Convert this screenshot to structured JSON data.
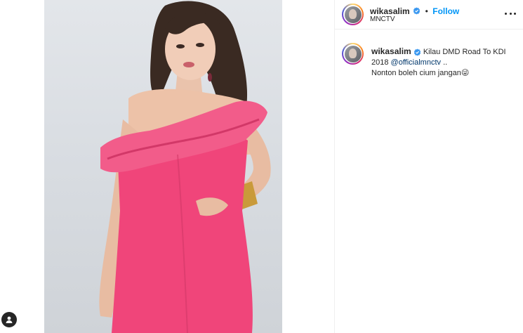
{
  "post": {
    "author": {
      "username": "wikasalim",
      "verified": true,
      "location": "MNCTV"
    },
    "follow_label": "Follow",
    "separator": "•",
    "caption": {
      "username": "wikasalim",
      "text_before_mention": "Kilau DMD Road To KDI 2018 ",
      "mention": "@officialmnctv",
      "text_after_mention": " ..",
      "line2": "Nonton boleh cium jangan",
      "emoji": "😜"
    }
  },
  "icons": {
    "more": "more-options-icon",
    "verified": "verified-badge-icon",
    "tag": "user-tag-icon"
  },
  "colors": {
    "accent": "#0095f6",
    "mention": "#00376b",
    "dress": "#f0457a",
    "background_photo": "#dadee3"
  }
}
